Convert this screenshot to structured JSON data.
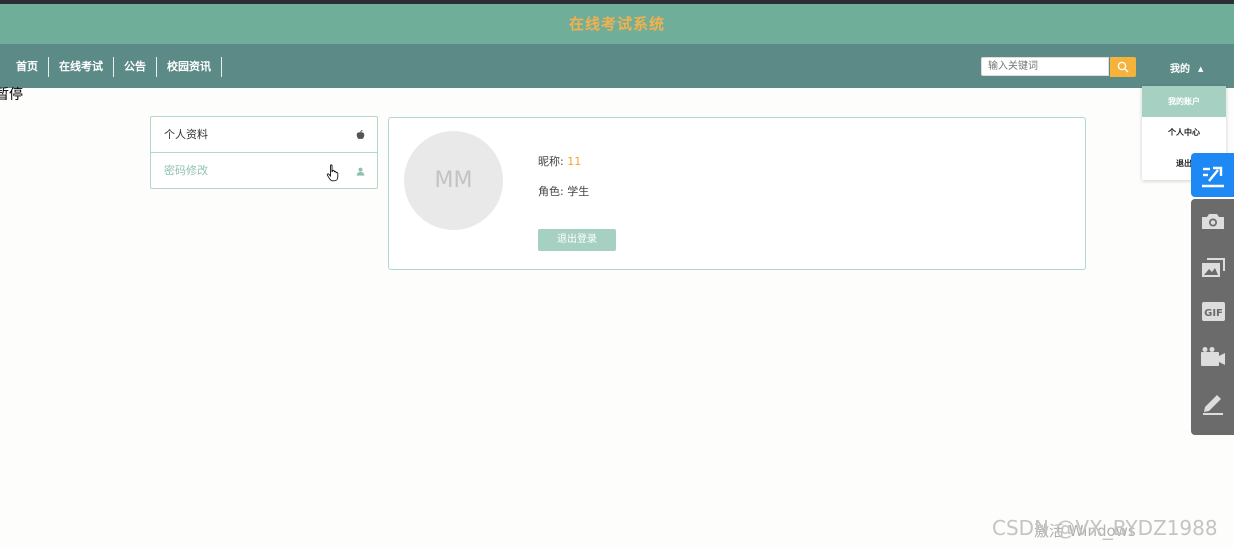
{
  "app": {
    "title": "在线考试系统"
  },
  "nav": {
    "links": [
      "首页",
      "在线考试",
      "公告",
      "校园资讯"
    ],
    "search_placeholder": "输入关键词",
    "mine_label": "我的"
  },
  "dropdown": {
    "items": [
      "我的账户",
      "个人中心",
      "退出"
    ]
  },
  "overlay": {
    "paused_text": "暂停"
  },
  "sidebar": {
    "items": [
      "个人资料",
      "密码修改"
    ]
  },
  "profile": {
    "avatar_initials": "MM",
    "nickname_label": "昵称:",
    "nickname_value": "11",
    "role_label": "角色:",
    "role_value": "学生",
    "logout_label": "退出登录"
  },
  "watermark": {
    "csdn": "CSDN @VX_BYDZ1988",
    "windows": "激活 Windows"
  },
  "icons": {
    "search": "search-icon",
    "caret": "caret-down-icon",
    "apple": "apple-icon",
    "user": "user-icon",
    "hand": "hand-cursor-icon",
    "share": "share-icon",
    "camera": "camera-icon",
    "image": "image-icon",
    "gif": "gif-icon",
    "video": "video-icon",
    "pen": "pen-icon"
  },
  "colors": {
    "title_bar": "#6fae99",
    "nav_bar": "#5c8a87",
    "title_text": "#f2b04f",
    "accent": "#a6d0c1",
    "search_button": "#f5b33b",
    "share_button": "#1e88f5"
  }
}
